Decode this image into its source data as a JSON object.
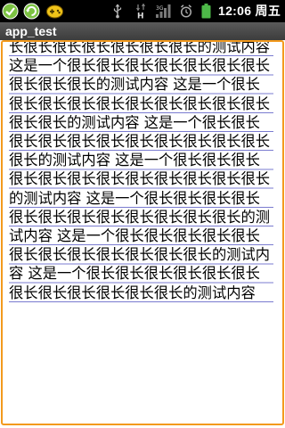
{
  "status_bar": {
    "time": "12:06",
    "weekday": "周五",
    "notification_icons": [
      "sync-check-icon",
      "sync-refresh-icon",
      "game-controller-icon"
    ],
    "status_icons": [
      "usb-icon",
      "data-h-icon",
      "signal-icon",
      "alarm-icon",
      "battery-icon"
    ]
  },
  "title_bar": {
    "title": "app_test"
  },
  "main": {
    "editor_text": "长很长很长很长很长很长很长的测试内容 这是一个很长很长很长很长很长很长很长很长很长很长的测试内容 这是一个很长很长很长很长很长很长很长很长很长很长很长很长的测试内容 这是一个很长很长很长很长很长很长很长很长很长很长很长很长的测试内容 这是一个很长很长很长很长很长很长很长很长很长很长很长很长的测试内容 这是一个很长很长很长很长很长很长很长很长很长很长很长很长的测试内容 这是一个很长很长很长很长很长很长很长很长很长很长很长很长的测试内容 这是一个很长很长很长很长很长很长很长很长很长很长很长很长的测试内容"
  },
  "colors": {
    "focus_border": "#f39a1d",
    "ruled_line": "#7a7bd0",
    "title_bar_bg": "#4a4a4a"
  }
}
